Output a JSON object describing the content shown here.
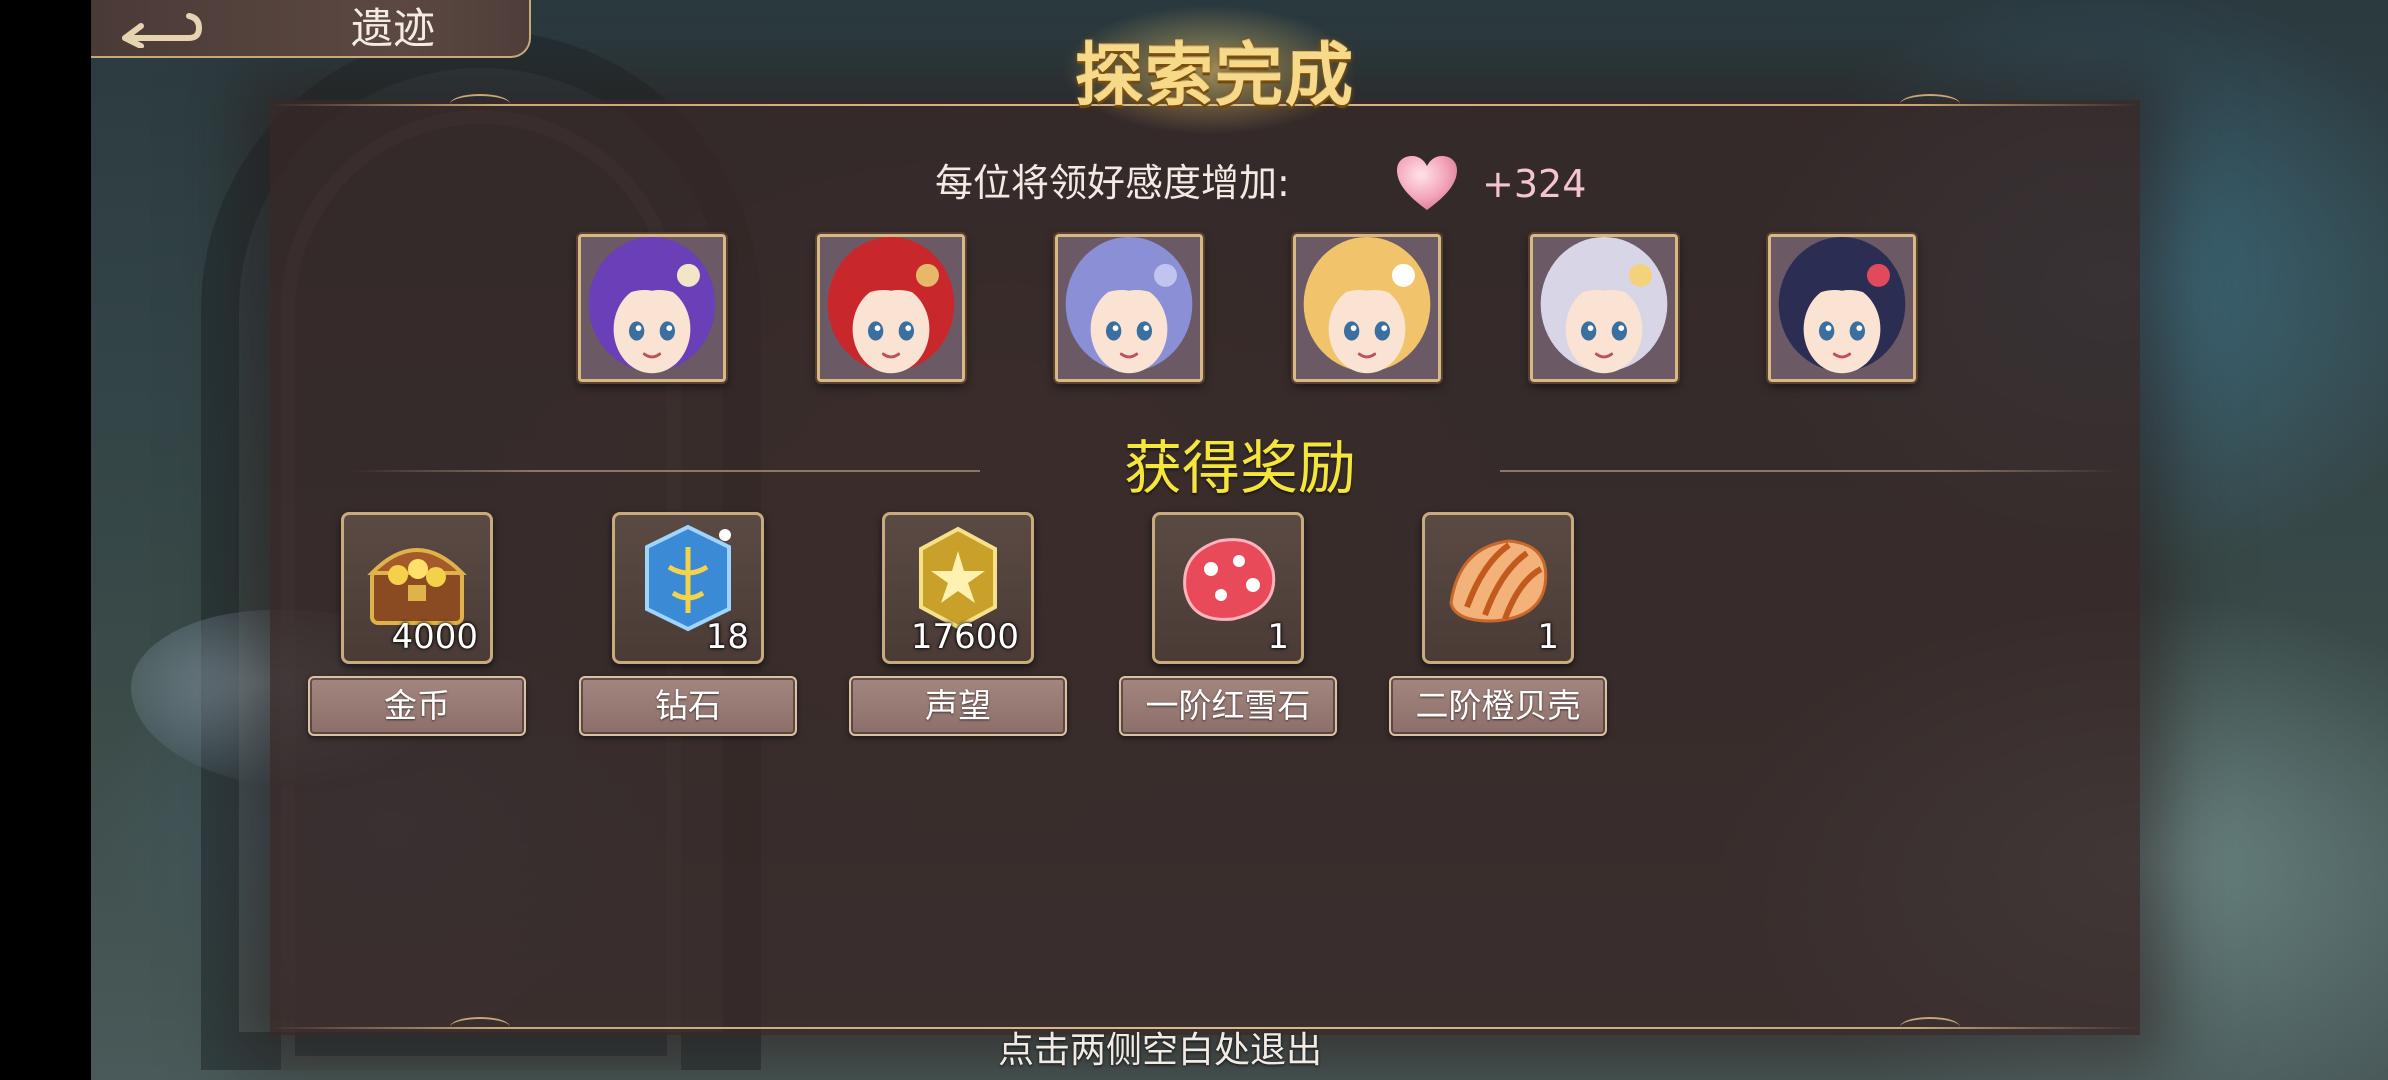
{
  "header": {
    "back_title": "遗迹"
  },
  "dialog": {
    "title": "探索完成",
    "affection_label": "每位将领好感度增加:",
    "affection_value": "+324",
    "rewards_title": "获得奖励",
    "exit_hint": "点击两侧空白处退出"
  },
  "characters": [
    {
      "hair": "#6a3fb8",
      "accent": "#f3e6c8"
    },
    {
      "hair": "#c8282c",
      "accent": "#e8b86a"
    },
    {
      "hair": "#8a8fd6",
      "accent": "#c0c4ee"
    },
    {
      "hair": "#f1c36a",
      "accent": "#ffffff"
    },
    {
      "hair": "#d8d6e6",
      "accent": "#f4d27a"
    },
    {
      "hair": "#2b2e52",
      "accent": "#e04a5a"
    }
  ],
  "rewards": [
    {
      "label": "金币",
      "quantity": "4000",
      "icon": "treasure-chest-icon"
    },
    {
      "label": "钻石",
      "quantity": "18",
      "icon": "diamond-crystal-icon"
    },
    {
      "label": "声望",
      "quantity": "17600",
      "icon": "reputation-badge-icon"
    },
    {
      "label": "一阶红雪石",
      "quantity": "1",
      "icon": "red-snow-stone-icon"
    },
    {
      "label": "二阶橙贝壳",
      "quantity": "1",
      "icon": "orange-shell-icon"
    }
  ],
  "colors": {
    "title_gold": "#f7d98a",
    "rewards_yellow": "#f5e63c",
    "affection_pink": "#f4c4cf",
    "panel_bg": "#37262a"
  }
}
